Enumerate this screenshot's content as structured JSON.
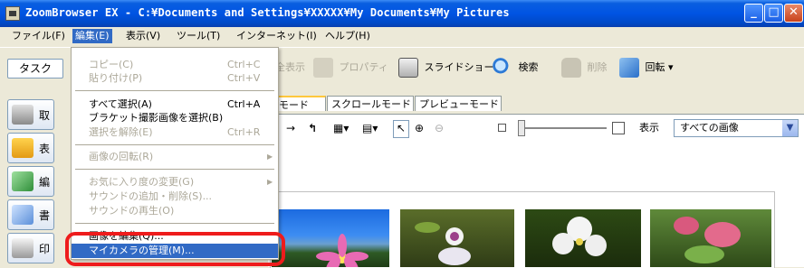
{
  "window": {
    "title": "ZoomBrowser EX  -  C:¥Documents and Settings¥XXXXX¥My Documents¥My Pictures"
  },
  "menubar": {
    "items": [
      {
        "label": "ファイル(F)"
      },
      {
        "label": "編集(E)"
      },
      {
        "label": "表示(V)"
      },
      {
        "label": "ツール(T)"
      },
      {
        "label": "インターネット(I)"
      },
      {
        "label": "ヘルプ(H)"
      }
    ]
  },
  "toolbar": {
    "task_label": "タスク",
    "buttons": [
      {
        "label": "全表示",
        "icon": "fullscreen-icon"
      },
      {
        "label": "プロパティ",
        "icon": "properties-icon"
      },
      {
        "label": "スライドショー",
        "icon": "slideshow-icon"
      },
      {
        "label": "検索",
        "icon": "search-icon"
      },
      {
        "label": "削除",
        "icon": "delete-icon"
      },
      {
        "label": "回転 ▾",
        "icon": "rotate-icon"
      }
    ]
  },
  "left_panel": {
    "items": [
      {
        "label": "取"
      },
      {
        "label": "表"
      },
      {
        "label": "編"
      },
      {
        "label": "書"
      },
      {
        "label": "印"
      }
    ]
  },
  "view_tabs": [
    {
      "label": "ムモード"
    },
    {
      "label": "スクロールモード"
    },
    {
      "label": "プレビューモード"
    }
  ],
  "view_toolbar": {
    "display_label": "表示",
    "filter_value": "すべての画像"
  },
  "edit_menu": {
    "items": [
      {
        "label": "コピー(C)",
        "shortcut": "Ctrl+C",
        "enabled": false
      },
      {
        "label": "貼り付け(P)",
        "shortcut": "Ctrl+V",
        "enabled": false
      },
      {
        "label": "すべて選択(A)",
        "shortcut": "Ctrl+A",
        "enabled": true
      },
      {
        "label": "ブラケット撮影画像を選択(B)",
        "shortcut": "",
        "enabled": true
      },
      {
        "label": "選択を解除(E)",
        "shortcut": "Ctrl+R",
        "enabled": false
      },
      {
        "label": "画像の回転(R)",
        "shortcut": "",
        "enabled": false
      },
      {
        "label": "お気に入り度の変更(G)",
        "shortcut": "",
        "enabled": false
      },
      {
        "label": "サウンドの追加・削除(S)...",
        "shortcut": "",
        "enabled": false
      },
      {
        "label": "サウンドの再生(O)",
        "shortcut": "",
        "enabled": false
      },
      {
        "label": "画像を編集(Q)...",
        "shortcut": "",
        "enabled": true
      },
      {
        "label": "マイカメラの管理(M)...",
        "shortcut": "",
        "enabled": true
      }
    ]
  },
  "colors": {
    "titlebar": "#0054e3",
    "menu_highlight": "#316ac5",
    "callout_ring": "#ee1c1c"
  }
}
